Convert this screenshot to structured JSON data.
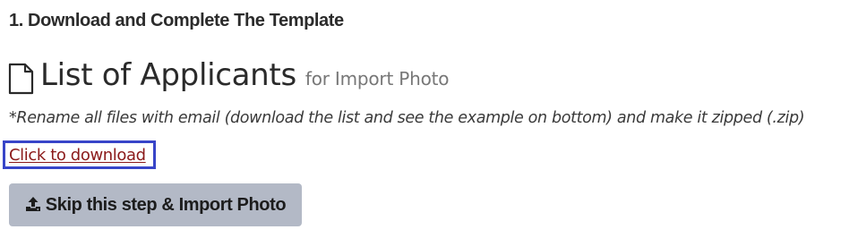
{
  "step": {
    "heading": "1. Download and Complete The Template"
  },
  "title": {
    "icon": "file-outline-icon",
    "main": "List of Applicants",
    "sub": "for Import Photo"
  },
  "note": "*Rename all files with email (download the list and see the example on bottom) and make it zipped (.zip)",
  "download_link": {
    "label": "Click to download",
    "color": "#8b1a1a",
    "focus_border_color": "#3845c8"
  },
  "skip_button": {
    "icon": "upload-icon",
    "label": "Skip this step & Import Photo",
    "background": "#b3b9c6"
  }
}
